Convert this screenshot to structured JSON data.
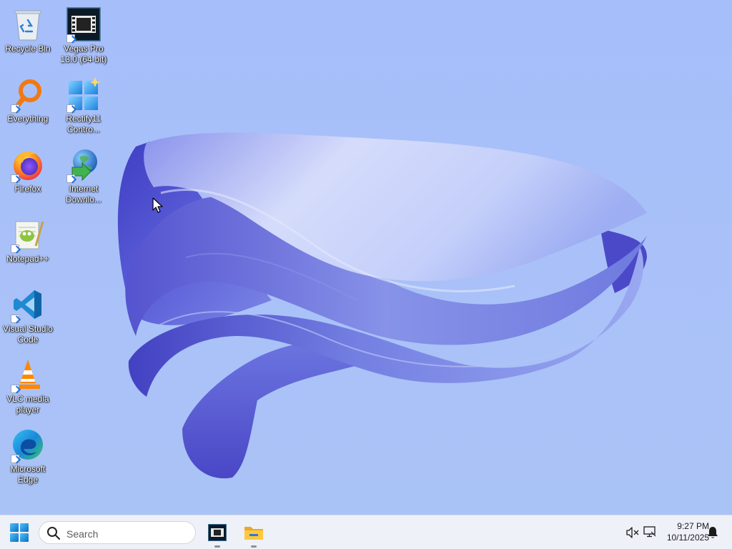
{
  "desktop": {
    "icons": [
      {
        "label_line1": "Recycle Bin",
        "label_line2": "",
        "icon": "recycle-bin-icon",
        "shortcut": false
      },
      {
        "label_line1": "Vegas Pro",
        "label_line2": "13.0 (64-bit)",
        "icon": "vegas-pro-icon",
        "shortcut": true
      },
      {
        "label_line1": "Everything",
        "label_line2": "",
        "icon": "everything-search-icon",
        "shortcut": true
      },
      {
        "label_line1": "Rectify11",
        "label_line2": "Contro...",
        "icon": "rectify11-icon",
        "shortcut": true
      },
      {
        "label_line1": "Firefox",
        "label_line2": "",
        "icon": "firefox-icon",
        "shortcut": true
      },
      {
        "label_line1": "Internet",
        "label_line2": "Downlo...",
        "icon": "internet-download-manager-icon",
        "shortcut": true
      },
      {
        "label_line1": "Notepad++",
        "label_line2": "",
        "icon": "notepad-plus-plus-icon",
        "shortcut": true
      },
      {
        "label_line1": "Visual Studio",
        "label_line2": "Code",
        "icon": "vscode-icon",
        "shortcut": true
      },
      {
        "label_line1": "VLC media",
        "label_line2": "player",
        "icon": "vlc-icon",
        "shortcut": true
      },
      {
        "label_line1": "Microsoft",
        "label_line2": "Edge",
        "icon": "edge-icon",
        "shortcut": true
      }
    ]
  },
  "taskbar": {
    "start_icon": "windows-start-icon",
    "search": {
      "placeholder": "Search",
      "value": ""
    },
    "pinned_apps": [
      {
        "icon": "vegas-pro-icon",
        "running": true
      },
      {
        "icon": "file-explorer-icon",
        "running": true
      }
    ],
    "tray": {
      "icons": [
        "sound-muted-icon",
        "network-icon",
        "notification-bell-icon"
      ],
      "time": "9:27 PM",
      "date": "10/11/2025"
    }
  },
  "colors": {
    "wallpaper_bg": "#a9c0f7",
    "bloom_dark": "#4a48c9",
    "bloom_light": "#c9d3fb",
    "taskbar_bg": "#eef1f8",
    "start_blue": "#0f6cbd"
  }
}
